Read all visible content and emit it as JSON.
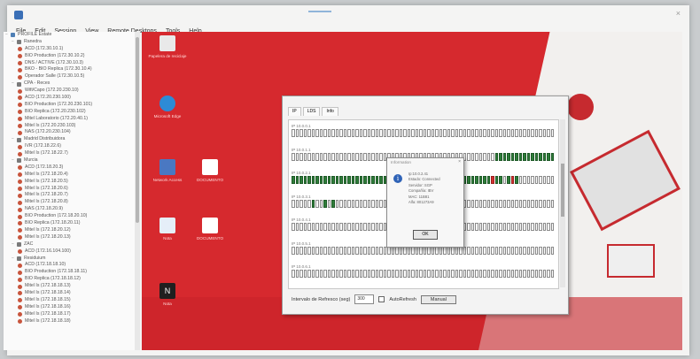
{
  "window": {
    "title": "",
    "menu": [
      "File",
      "Edit",
      "Session",
      "View",
      "Remote Desktops",
      "Tools",
      "Help"
    ]
  },
  "tree": [
    {
      "level": 0,
      "kind": "root",
      "label": "PROFILE Estate",
      "expanded": true
    },
    {
      "level": 1,
      "kind": "folder",
      "label": "Ranedra",
      "expanded": true
    },
    {
      "level": 2,
      "kind": "host",
      "label": "ACD (172.30.10.1)"
    },
    {
      "level": 2,
      "kind": "host",
      "label": "BIO Production (172.30.10.2)"
    },
    {
      "level": 2,
      "kind": "host",
      "label": "DNS / ACTIVE (172.30.10.3)"
    },
    {
      "level": 2,
      "kind": "host",
      "label": "BKO - BIO Replica (172.30.10.4)"
    },
    {
      "level": 2,
      "kind": "host",
      "label": "Operador Salle (172.30.10.5)"
    },
    {
      "level": 1,
      "kind": "folder",
      "label": "CPA - Reces",
      "expanded": true
    },
    {
      "level": 2,
      "kind": "host",
      "label": "Wifi/Capo (172.20.230.10)"
    },
    {
      "level": 2,
      "kind": "host",
      "label": "ACD (172.20.230.100)"
    },
    {
      "level": 2,
      "kind": "host",
      "label": "BIO Production (172.20.230.101)"
    },
    {
      "level": 2,
      "kind": "host",
      "label": "BIO Replica (172.20.230.102)"
    },
    {
      "level": 2,
      "kind": "host",
      "label": "Mitel Laboratorio (172.20.40.1)"
    },
    {
      "level": 2,
      "kind": "host",
      "label": "Mitel Is (172.20.230.103)"
    },
    {
      "level": 2,
      "kind": "host",
      "label": "NAS (172.20.230.104)"
    },
    {
      "level": 1,
      "kind": "folder",
      "label": "Madrid Distribuidora",
      "expanded": true
    },
    {
      "level": 2,
      "kind": "host",
      "label": "IVR (172.18.22.6)"
    },
    {
      "level": 2,
      "kind": "host",
      "label": "Mitel Is (172.18.22.7)"
    },
    {
      "level": 1,
      "kind": "folder",
      "label": "Murcia",
      "expanded": true
    },
    {
      "level": 2,
      "kind": "host",
      "label": "ACD (172.18.20.3)"
    },
    {
      "level": 2,
      "kind": "host",
      "label": "Mitel Is (172.18.20.4)"
    },
    {
      "level": 2,
      "kind": "host",
      "label": "Mitel Is (172.18.20.5)"
    },
    {
      "level": 2,
      "kind": "host",
      "label": "Mitel Is (172.18.20.6)"
    },
    {
      "level": 2,
      "kind": "host",
      "label": "Mitel Is (172.18.20.7)"
    },
    {
      "level": 2,
      "kind": "host",
      "label": "Mitel Is (172.18.20.8)"
    },
    {
      "level": 2,
      "kind": "host",
      "label": "NAS (172.18.20.9)"
    },
    {
      "level": 2,
      "kind": "host",
      "label": "BIO Production (172.18.20.10)"
    },
    {
      "level": 2,
      "kind": "host",
      "label": "BIO Replica (172.18.20.11)"
    },
    {
      "level": 2,
      "kind": "host",
      "label": "Mitel Is (172.18.20.12)"
    },
    {
      "level": 2,
      "kind": "host",
      "label": "Mitel Is (172.18.20.13)"
    },
    {
      "level": 1,
      "kind": "folder",
      "label": "ZAC",
      "expanded": true
    },
    {
      "level": 2,
      "kind": "host",
      "label": "ACD (172.16.104.100)"
    },
    {
      "level": 1,
      "kind": "folder",
      "label": "Residuium",
      "expanded": true
    },
    {
      "level": 2,
      "kind": "host",
      "label": "ACD (172.18.18.10)"
    },
    {
      "level": 2,
      "kind": "host",
      "label": "BIO Production (172.18.18.11)"
    },
    {
      "level": 2,
      "kind": "host",
      "label": "BIO Replica (172.18.18.12)"
    },
    {
      "level": 2,
      "kind": "host",
      "label": "Mitel Is (172.18.18.13)"
    },
    {
      "level": 2,
      "kind": "host",
      "label": "Mitel Is (172.18.18.14)"
    },
    {
      "level": 2,
      "kind": "host",
      "label": "Mitel Is (172.18.18.15)"
    },
    {
      "level": 2,
      "kind": "host",
      "label": "Mitel Is (172.18.18.16)"
    },
    {
      "level": 2,
      "kind": "host",
      "label": "Mitel Is (172.18.18.17)"
    },
    {
      "level": 2,
      "kind": "host",
      "label": "Mitel Is (172.18.18.18)"
    }
  ],
  "desktop_icons": [
    {
      "id": "recycle",
      "label": "Papelera de reciclaje",
      "color": "#e9e9e9"
    },
    {
      "id": "edge",
      "label": "Microsoft Edge",
      "color": "#2d8bd6"
    },
    {
      "id": "network",
      "label": "Network Access",
      "color": "#4a78c2"
    },
    {
      "id": "doc1",
      "label": "DOCUMENTO",
      "color": "#ffffff"
    },
    {
      "id": "notepad",
      "label": "Nota",
      "color": "#e5eef8"
    },
    {
      "id": "doc2",
      "label": "DOCUMENTO",
      "color": "#ffffff"
    },
    {
      "id": "ntool",
      "label": "Nota",
      "color": "#1f1f1f"
    }
  ],
  "scanner": {
    "title": "",
    "tabs": [
      "IP",
      "LDS",
      "Info"
    ],
    "rows": [
      {
        "label": "IP 10.0.0.1",
        "cells": "wwwwwwwwwwwwwwwwwwwwwwwwwwwwwwwwwwwwwwwwwwwwwwwwwwwwwwwwwwwwwwwwww"
      },
      {
        "label": "IP 10.0.1.1",
        "cells": "wwwwwwwwwwwwwwwwwwwwwwwwwwwwwwwwwwwwwwwwwwwwwwwwwwwggggggggggggggg"
      },
      {
        "label": "IP 10.0.2.1",
        "cells": "ggggggggggggggggggggggggggggggggwwwwwwwwggggggggggrggwgrgwwwwwwwww"
      },
      {
        "label": "IP 10.0.3.1",
        "cells": "wwwwwgwwgwgwwwwwwwwwwwwwwwwwwwwwwwwwwwwwwwwwwwwwwwwwwwwwwwwwwwwwww"
      },
      {
        "label": "IP 10.0.4.1",
        "cells": "wwwwwwwwwwwwwwwwwwwwwwwwwwwwwwwwwwwwwwwwwwwwwwwwwwwwwwwwwwwwwwwwww"
      },
      {
        "label": "IP 10.0.5.1",
        "cells": "wwwwwwwwwwwwwwwwwwwwwwwwwwwwwwwwwwwwwwwwwwwwwwwwwwwwwwwwwwwwwwwwww"
      },
      {
        "label": "IP 10.0.6.1",
        "cells": "wwwwwwwwwwwwwwwwwwwwwwwwwwwwwwwwwwwwwwwwwwwwwwwwwwwwwwwwwwwwwwwwww"
      }
    ],
    "footer": {
      "interval_label": "Intervalo de Refresco (seg)",
      "interval_value": "300",
      "autorefresh_label": "AutoRefresh",
      "manual_label": "Manual"
    }
  },
  "info_dialog": {
    "title": "Information",
    "lines": [
      "Ip:10.0.2.41",
      "Estado: Connected",
      "Servidor: SGP",
      "Compañía: IBV",
      "MAC: 11B81",
      "Alfa: 801273A9"
    ],
    "ok_label": "OK"
  }
}
